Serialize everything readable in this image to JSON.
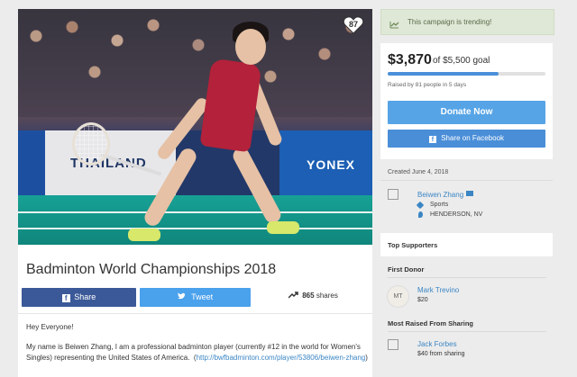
{
  "campaign": {
    "title": "Badminton World Championships 2018",
    "likes": "87",
    "hero_sponsor_text": "THAILAND",
    "hero_sponsor_text2": "YONEX"
  },
  "share": {
    "facebook_label": "Share",
    "twitter_label": "Tweet",
    "shares_count": "865",
    "shares_label": "shares"
  },
  "story": {
    "greeting": "Hey Everyone!",
    "p1": "My name is Beiwen Zhang, I am a professional badminton player (currently #12 in the world for Women's Singles) representing the United States of America.",
    "link": "http://bwfbadminton.com/player/53806/beiwen-zhang",
    "p1_close": ")",
    "p1_open": "("
  },
  "sidebar": {
    "trending_text": "This campaign is trending!",
    "raised_amount": "$3,870",
    "goal_text": "of $5,500 goal",
    "progress_fraction": 0.7036,
    "raised_by": "Raised by 81 people in 5 days",
    "donate_label": "Donate Now",
    "share_fb_label": "Share on Facebook",
    "created": "Created June 4, 2018",
    "organizer": {
      "name": "Beiwen Zhang",
      "category": "Sports",
      "location": "HENDERSON, NV"
    },
    "top_supporters_heading": "Top Supporters",
    "first_donor_heading": "First Donor",
    "first_donor": {
      "initials": "MT",
      "name": "Mark Trevino",
      "amount": "$20"
    },
    "most_raised_heading": "Most Raised From Sharing",
    "most_raised": {
      "name": "Jack Forbes",
      "amount": "$40 from sharing"
    }
  },
  "colors": {
    "facebook": "#3b5998",
    "twitter": "#4aa1ec",
    "donate": "#56a4e6",
    "link": "#3b86c4",
    "trend_bg": "#dfe8d6"
  }
}
